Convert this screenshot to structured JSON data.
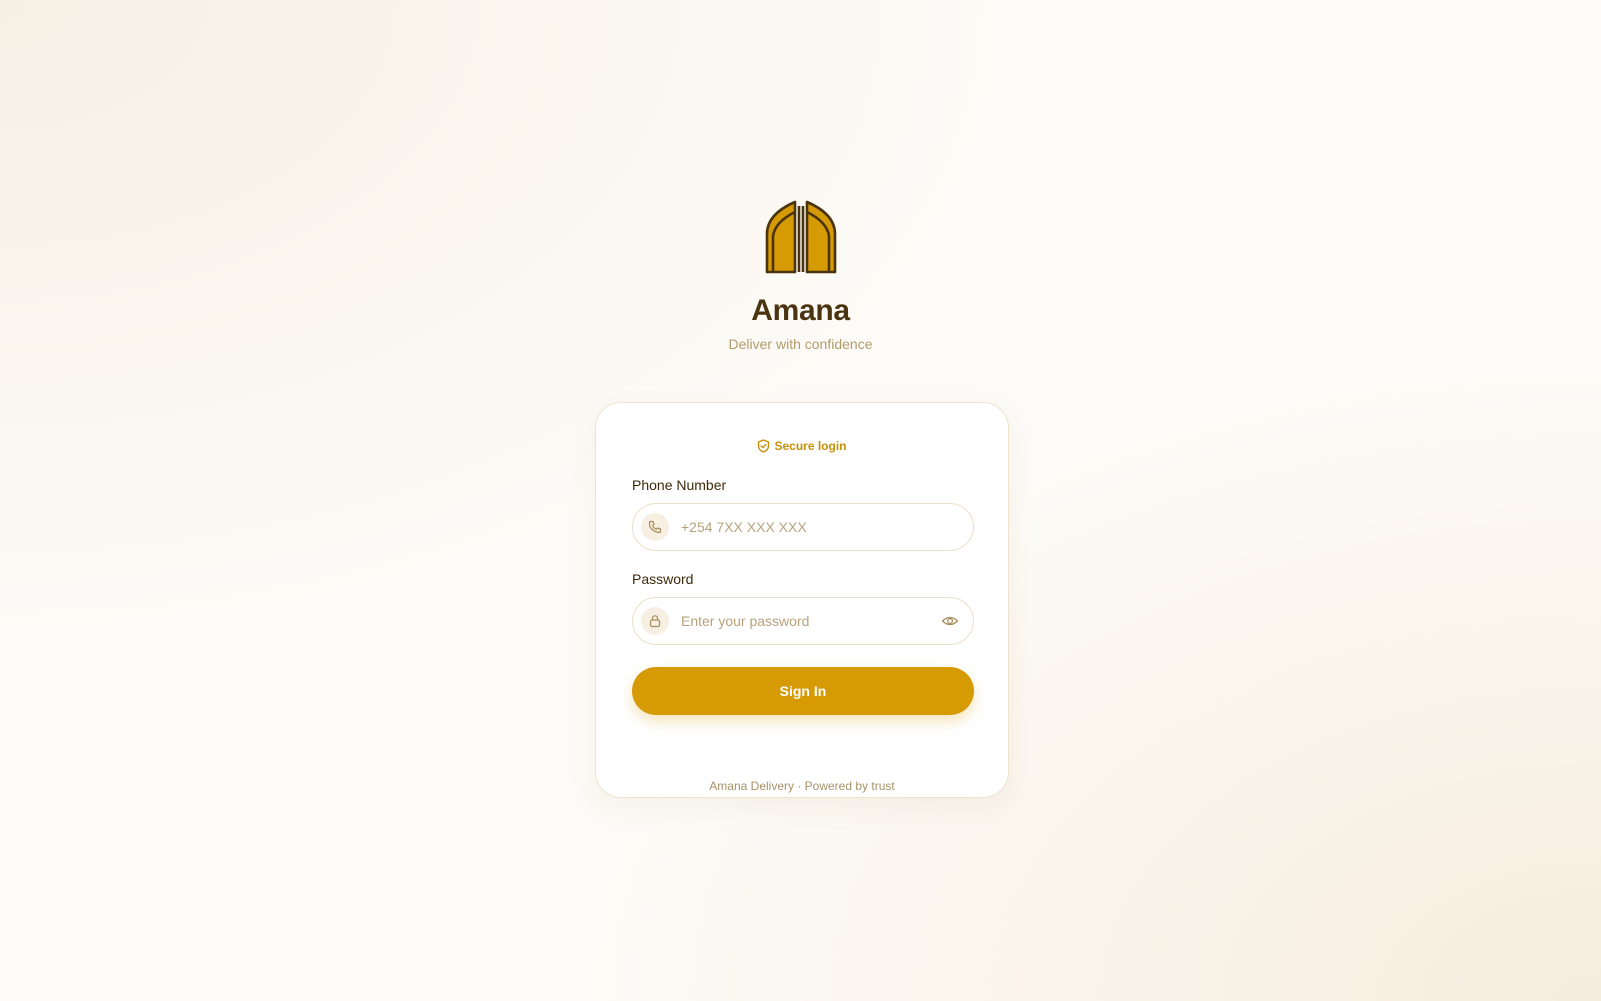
{
  "brand": {
    "logo_icon": "arched-gates-logo",
    "title": "Amana",
    "tagline": "Deliver with confidence"
  },
  "login_card": {
    "secure_label": "Secure login",
    "secure_icon": "shield-check-icon",
    "phone": {
      "label": "Phone Number",
      "placeholder": "+254 7XX XXX XXX",
      "value": "",
      "icon": "phone-icon"
    },
    "password": {
      "label": "Password",
      "placeholder": "Enter your password",
      "value": "",
      "icon": "lock-icon",
      "toggle_icon": "eye-icon"
    },
    "sign_in_label": "Sign In",
    "footer": "Amana Delivery · Powered by trust"
  },
  "colors": {
    "accent": "#d69a05",
    "brand_dark": "#4a3410",
    "muted": "#b39b6b",
    "background": "#fdfbf7"
  }
}
